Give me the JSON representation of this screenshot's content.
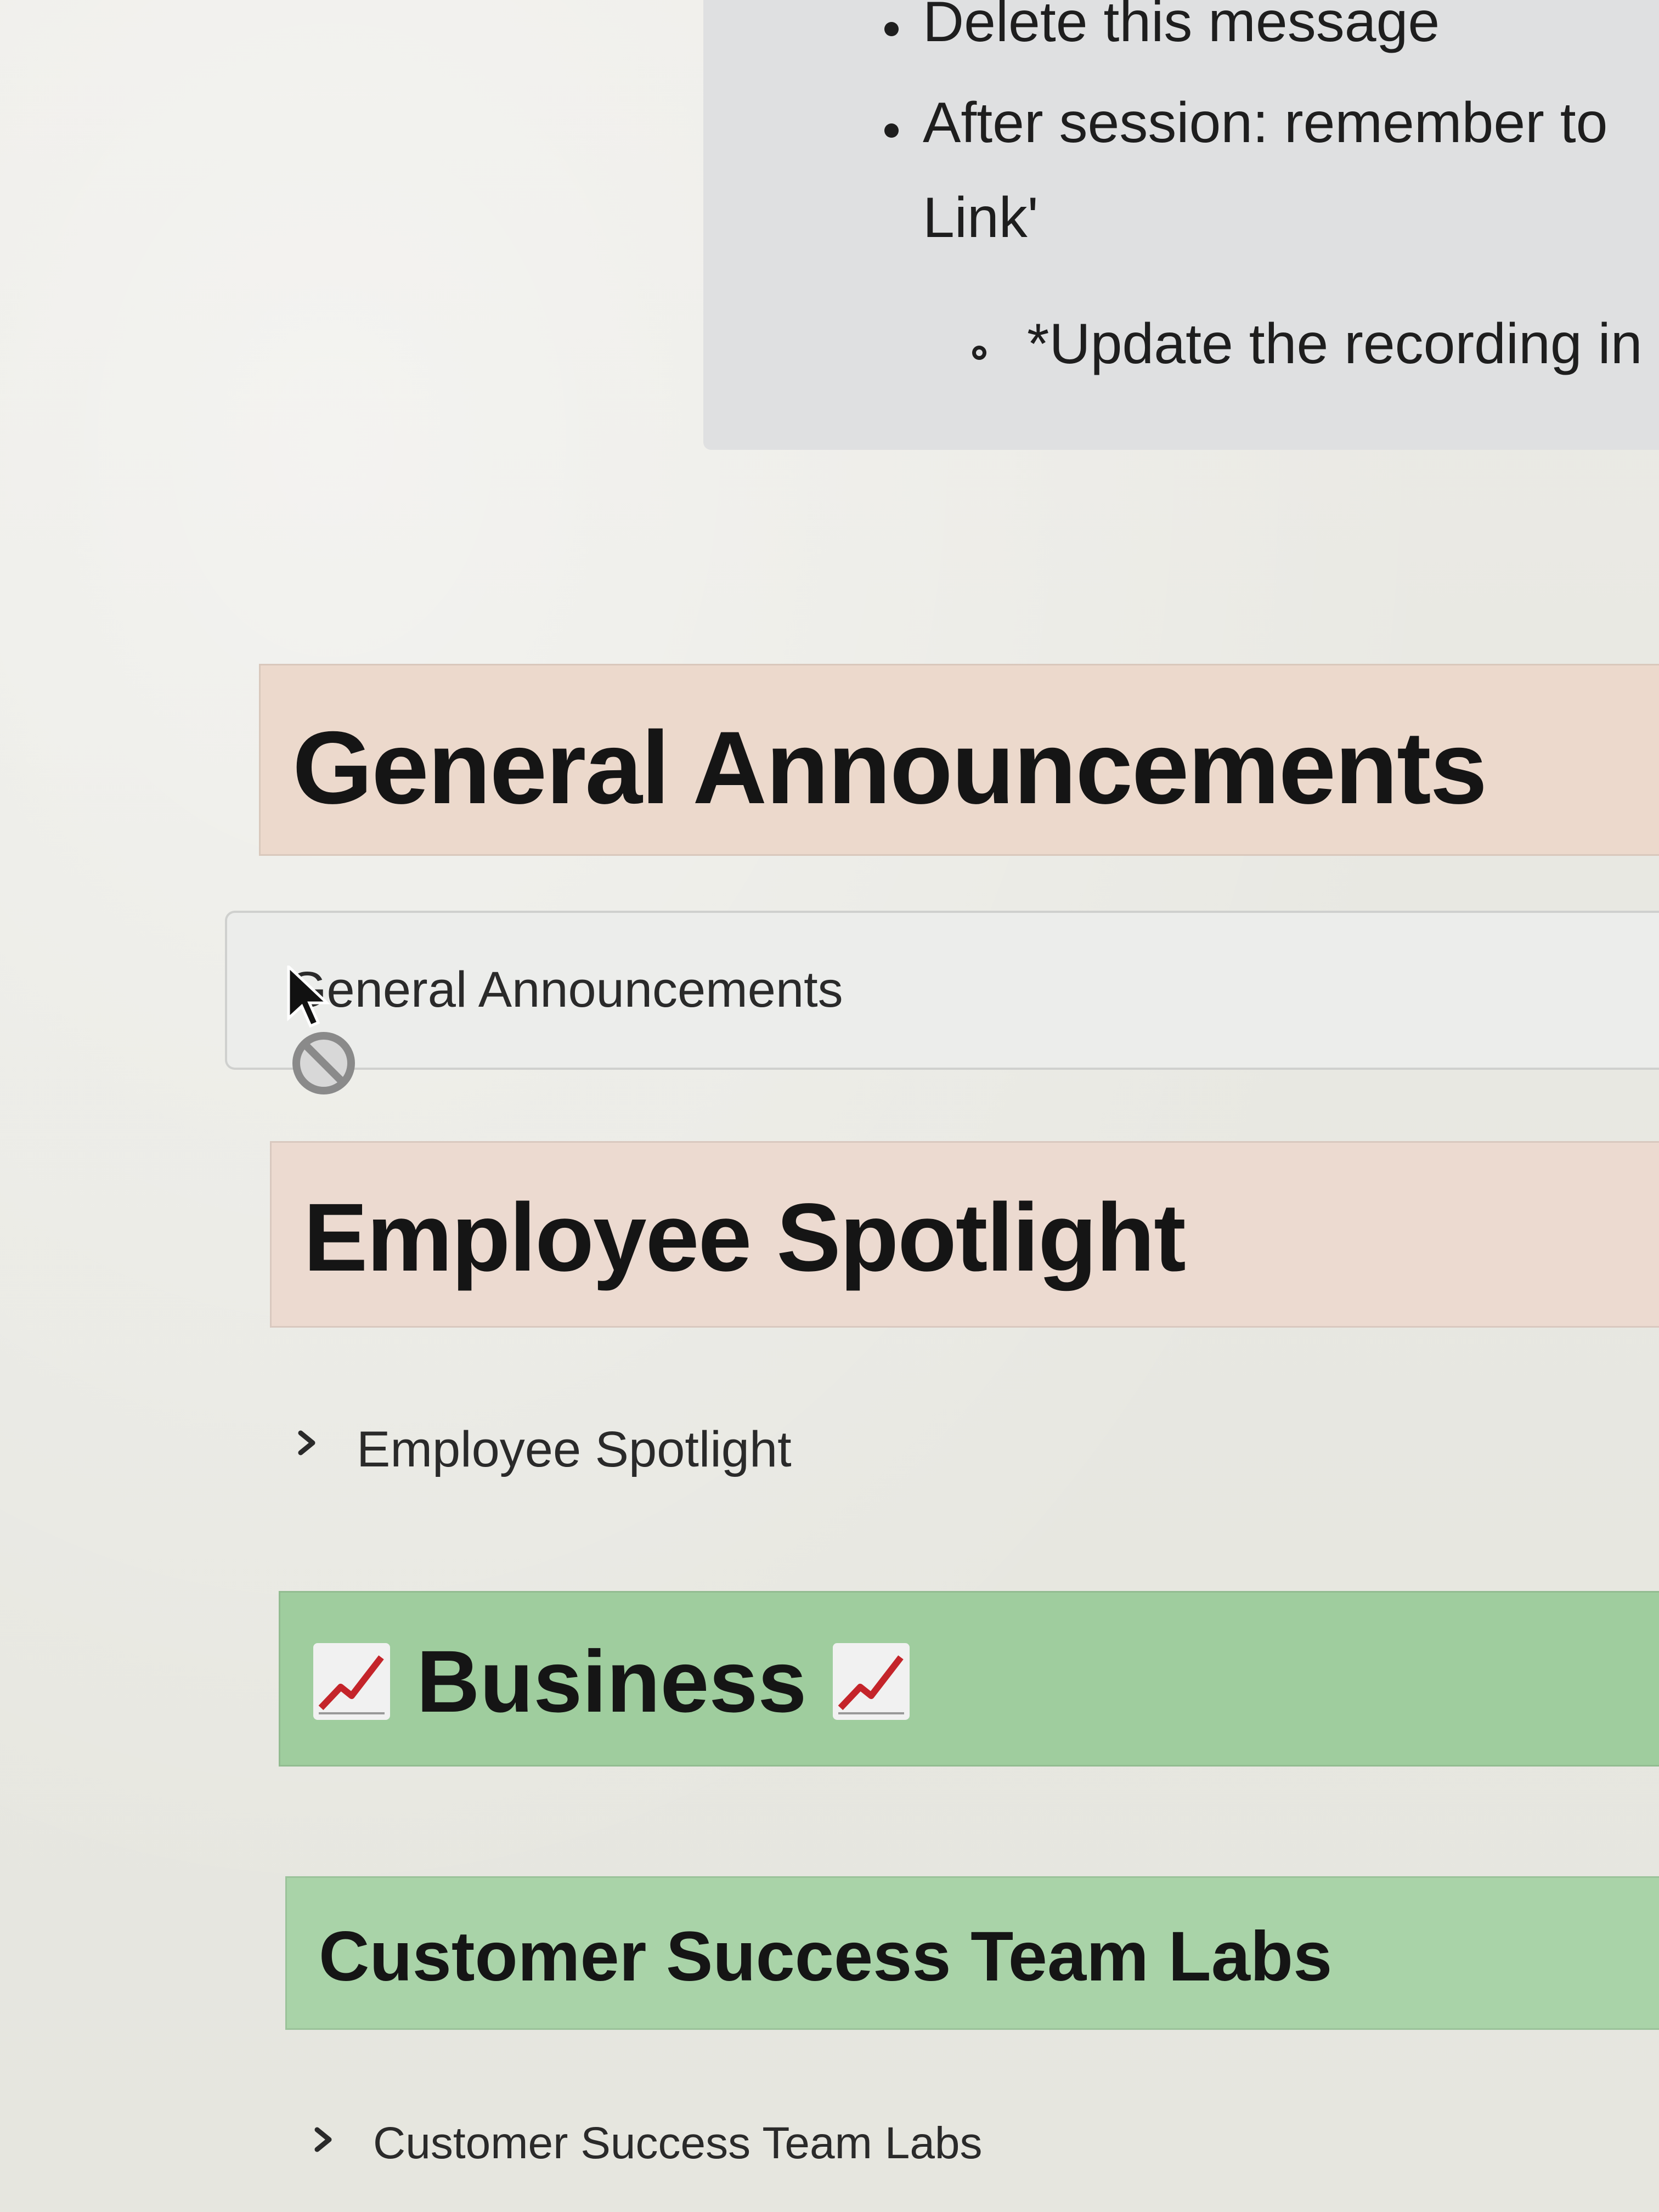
{
  "callout": {
    "items": [
      {
        "text": "Delete this message",
        "level": 1
      },
      {
        "text": "After session: remember to",
        "level": 1
      },
      {
        "text": "Link'",
        "level": 1,
        "continuation": true
      },
      {
        "text": "*Update the recording in",
        "level": 2
      }
    ]
  },
  "sections": {
    "general": {
      "heading": "General Announcements",
      "toggle_label": "General Announcements"
    },
    "spotlight": {
      "heading": "Employee Spotlight",
      "toggle_label": "Employee Spotlight"
    },
    "business": {
      "heading": "Business",
      "icon": "chart-increasing-emoji"
    },
    "labs": {
      "heading": "Customer Success Team Labs",
      "toggle_label": "Customer Success Team Labs"
    }
  },
  "colors": {
    "callout_bg": "#dfe0e1",
    "heading_red_bg": "#ecd9cc",
    "heading_green_bg": "#9fcd9e",
    "text": "#1f1f1f"
  },
  "cursor": {
    "state": "not-allowed"
  }
}
